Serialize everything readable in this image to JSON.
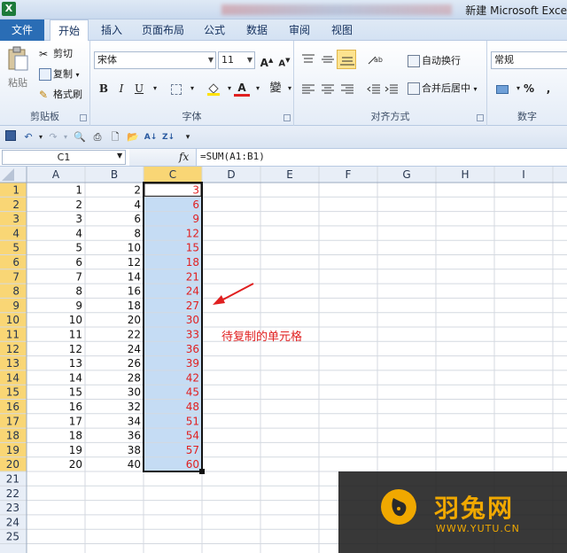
{
  "window": {
    "app_icon": "X",
    "title": "新建 Microsoft Exce"
  },
  "ribbon_tabs": [
    "文件",
    "开始",
    "插入",
    "页面布局",
    "公式",
    "数据",
    "审阅",
    "视图"
  ],
  "clipboard": {
    "paste": "粘贴",
    "cut": "剪切",
    "copy": "复制",
    "format_painter": "格式刷",
    "group_label": "剪贴板"
  },
  "font": {
    "name": "宋体",
    "size": "11",
    "grow": "A",
    "shrink": "A",
    "bold": "B",
    "italic": "I",
    "underline": "U",
    "font_color": "A",
    "phonetic": "變",
    "group_label": "字体",
    "font_color_hex": "#e02020",
    "highlight_hex": "#ffe100"
  },
  "alignment": {
    "wrap_text": "自动换行",
    "merge_center": "合并后居中",
    "group_label": "对齐方式"
  },
  "number": {
    "format": "常规",
    "percent": "%",
    "comma": ",",
    "group_label": "数字"
  },
  "formula_bar": {
    "name_box": "C1",
    "fx": "fx",
    "formula": "=SUM(A1:B1)"
  },
  "sheet": {
    "columns": [
      "A",
      "B",
      "C",
      "D",
      "E",
      "F",
      "G",
      "H",
      "I"
    ],
    "selected_column": "C",
    "row_numbers": [
      "1",
      "2",
      "3",
      "4",
      "5",
      "6",
      "7",
      "8",
      "9",
      "10",
      "11",
      "12",
      "13",
      "14",
      "15",
      "16",
      "17",
      "18",
      "19",
      "20",
      "21",
      "22",
      "23",
      "24",
      "25"
    ],
    "col_a": [
      "1",
      "2",
      "3",
      "4",
      "5",
      "6",
      "7",
      "8",
      "9",
      "10",
      "11",
      "12",
      "13",
      "14",
      "15",
      "16",
      "17",
      "18",
      "19",
      "20"
    ],
    "col_b": [
      "2",
      "4",
      "6",
      "8",
      "10",
      "12",
      "14",
      "16",
      "18",
      "20",
      "22",
      "24",
      "26",
      "28",
      "30",
      "32",
      "34",
      "36",
      "38",
      "40"
    ],
    "col_c": [
      "3",
      "6",
      "9",
      "12",
      "15",
      "18",
      "21",
      "24",
      "27",
      "30",
      "33",
      "36",
      "39",
      "42",
      "45",
      "48",
      "51",
      "54",
      "57",
      "60"
    ],
    "selected_rows": 20,
    "selection_fill": "#c5dcf4",
    "header_highlight": "#f9d675",
    "formula_color": "#e02020"
  },
  "annotation": {
    "note": "待复制的单元格",
    "color": "#e02020"
  },
  "watermark": {
    "name": "羽兔网",
    "url": "WWW.YUTU.CN",
    "color": "#f0a800"
  }
}
